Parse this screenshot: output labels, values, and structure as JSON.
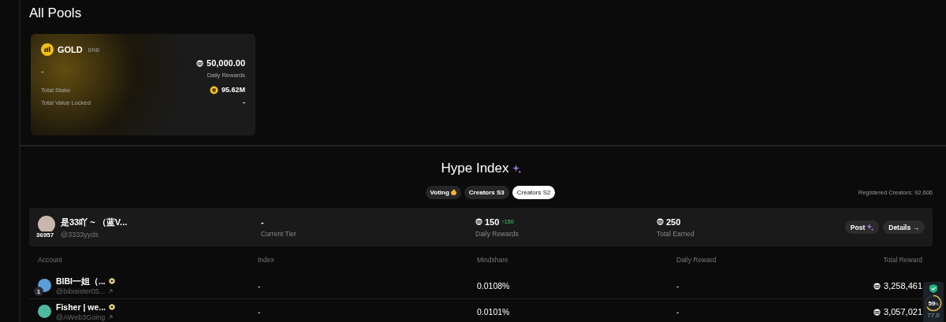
{
  "pools": {
    "title": "All Pools",
    "cards": [
      {
        "name": "GOLD",
        "chain": "BNB",
        "value": "-",
        "daily_rewards": "50,000.00",
        "daily_rewards_label": "Daily Rewards",
        "stats": [
          {
            "label": "Total Stake",
            "value": "95.62M",
            "kind": "coin"
          },
          {
            "label": "Total Value Locked",
            "value": "-",
            "kind": "plain"
          }
        ]
      }
    ]
  },
  "hype": {
    "title": "Hype Index",
    "tabs": [
      {
        "label": "Voting",
        "selected": false,
        "kind": "fire"
      },
      {
        "label": "Creators S3",
        "selected": false,
        "kind": "plain"
      },
      {
        "label": "Creators S2",
        "selected": true,
        "kind": "plain"
      }
    ],
    "registered": "Registered Creators: 92,606",
    "profile": {
      "name": "是33吖 ~ （蓝V...",
      "handle": "@3333yyds",
      "rank": "36957",
      "tier": "-",
      "tier_label": "Current Tier",
      "daily": "150",
      "daily_change": "↑150",
      "daily_label": "Daily Rewards",
      "earned": "250",
      "earned_label": "Total Earned",
      "buttons": [
        {
          "label": "Post",
          "kind": "sparkle"
        },
        {
          "label": "Details →",
          "kind": "plain"
        }
      ]
    },
    "table": {
      "columns": [
        "Account",
        "Index",
        "Mindshare",
        "Daily Reward",
        "Total Reward"
      ],
      "rows": [
        {
          "name": "BIBI一姐（...",
          "handle": "@bibisister05...",
          "rank": "1",
          "index": "-",
          "mindshare": "0.0108%",
          "daily_reward": "-",
          "total_reward": "3,258,461"
        },
        {
          "name": "Fisher | we...",
          "handle": "@AWeb3Going",
          "index": "-",
          "mindshare": "0.0101%",
          "daily_reward": "-",
          "total_reward": "3,057,021"
        }
      ]
    }
  },
  "widget": {
    "score": "59",
    "unit": "%",
    "sub": "77.0"
  }
}
